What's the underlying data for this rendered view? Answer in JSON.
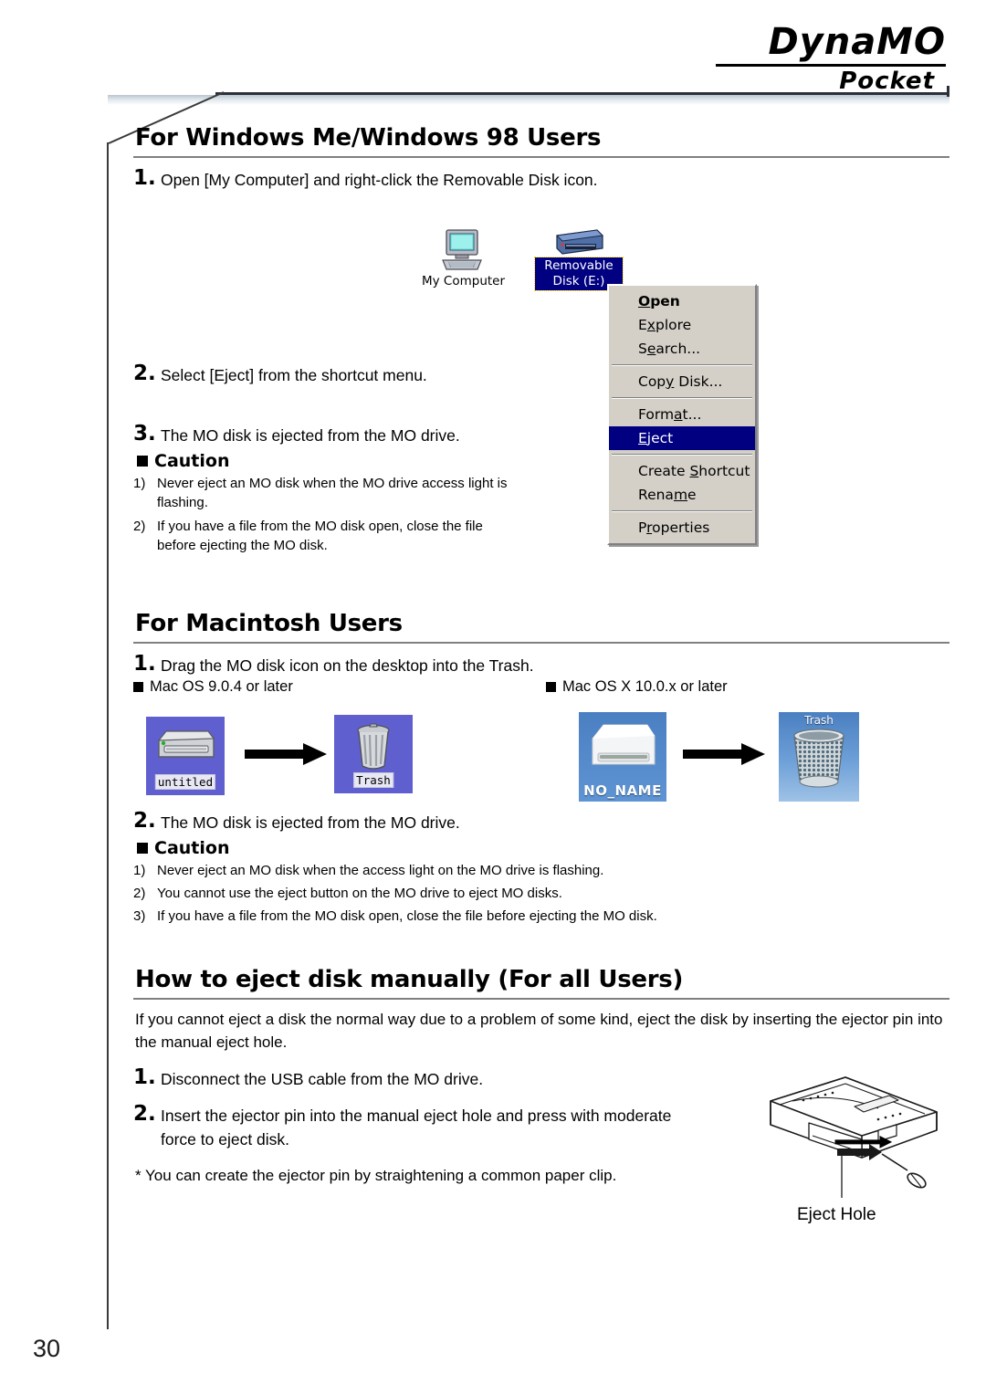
{
  "brand": {
    "name": "DynaMO",
    "sub": "Pocket"
  },
  "page_number": "30",
  "sections": {
    "windows": {
      "heading": "For Windows Me/Windows 98 Users",
      "steps": [
        {
          "num": "1.",
          "text": "Open [My Computer] and right-click the Removable Disk icon."
        },
        {
          "num": "2.",
          "text": "Select [Eject] from the shortcut menu."
        },
        {
          "num": "3.",
          "text": "The MO disk is ejected from the MO drive."
        }
      ],
      "caution_heading": "Caution",
      "cautions": [
        {
          "marker": "1)",
          "text": "Never eject an MO disk when the MO drive access light is flashing."
        },
        {
          "marker": "2)",
          "text": "If you have a file from the MO disk open, close the file before ejecting the MO disk."
        }
      ],
      "desktop": {
        "my_computer_label": "My Computer",
        "removable_label_line1": "Removable",
        "removable_label_line2": "Disk (E:)"
      },
      "context_menu": {
        "items": [
          {
            "label": "Open",
            "accel": "O",
            "bold": true,
            "selected": false,
            "sep_after": false
          },
          {
            "label": "Explore",
            "accel": "x",
            "bold": false,
            "selected": false,
            "sep_after": false
          },
          {
            "label": "Search...",
            "accel": "e",
            "bold": false,
            "selected": false,
            "sep_after": true
          },
          {
            "label": "Copy Disk...",
            "accel": "y",
            "bold": false,
            "selected": false,
            "sep_after": true
          },
          {
            "label": "Format...",
            "accel": "a",
            "bold": false,
            "selected": false,
            "sep_after": false
          },
          {
            "label": "Eject",
            "accel": "E",
            "bold": false,
            "selected": true,
            "sep_after": true
          },
          {
            "label": "Create Shortcut",
            "accel": "S",
            "bold": false,
            "selected": false,
            "sep_after": false
          },
          {
            "label": "Rename",
            "accel": "m",
            "bold": false,
            "selected": false,
            "sep_after": true
          },
          {
            "label": "Properties",
            "accel": "r",
            "bold": false,
            "selected": false,
            "sep_after": false
          }
        ],
        "highlight_color": "#000080",
        "face_color": "#d4d0c8"
      }
    },
    "macintosh": {
      "heading": "For Macintosh Users",
      "step1": {
        "num": "1.",
        "text": "Drag the MO disk icon on the desktop into the Trash."
      },
      "os_left_label": "Mac OS 9.0.4 or later",
      "os_right_label": "Mac OS X 10.0.x or later",
      "icons": {
        "os9_disk_label": "untitled",
        "os9_trash_label": "Trash",
        "osx_disk_label": "NO_NAME",
        "osx_trash_label": "Trash"
      },
      "step2": {
        "num": "2.",
        "text": "The MO disk is ejected from the MO drive."
      },
      "caution_heading": "Caution",
      "cautions": [
        {
          "marker": "1)",
          "text": "Never eject an MO disk when the access light on the MO drive is flashing."
        },
        {
          "marker": "2)",
          "text": "You cannot use the eject button on the MO drive to eject MO disks."
        },
        {
          "marker": "3)",
          "text": "If you have a file from the MO disk open, close the file before ejecting the MO disk."
        }
      ]
    },
    "manual_eject": {
      "heading": "How to eject disk manually (For all Users)",
      "intro": "If you cannot eject a disk the normal way due to a problem of some kind, eject the disk by inserting the ejector pin into the manual eject hole.",
      "steps": [
        {
          "num": "1.",
          "text": "Disconnect the USB cable from the MO drive."
        },
        {
          "num": "2.",
          "text": "Insert the ejector pin into the manual eject hole and press with moderate force to eject disk."
        }
      ],
      "note": "* You can create the ejector pin by straightening a common paper clip.",
      "figure_label": "Eject Hole"
    }
  }
}
